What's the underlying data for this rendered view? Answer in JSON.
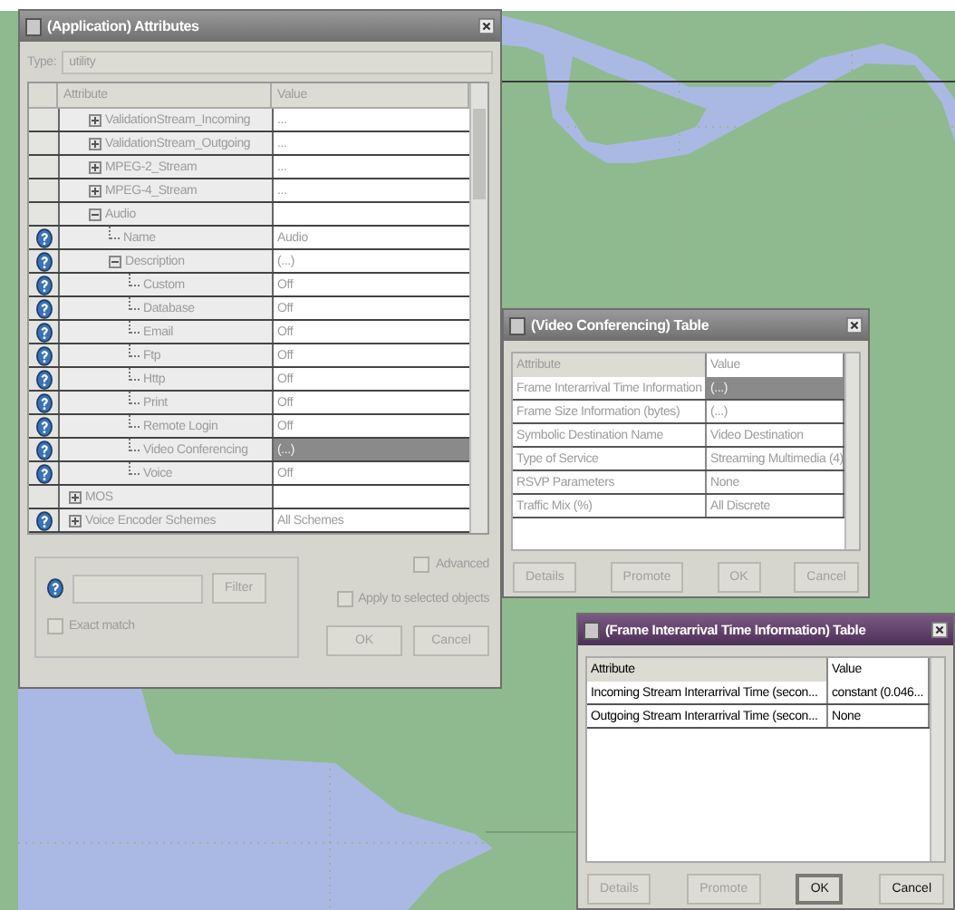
{
  "attributes_window": {
    "title": "(Application) Attributes",
    "active": false,
    "type_label": "Type:",
    "type_value": "utility",
    "columns": [
      "Attribute",
      "Value"
    ],
    "scrolled_rows": [
      {
        "attribute": "ValidationStream_Incoming",
        "value": "...",
        "help": false,
        "expanded": false,
        "selected": false
      },
      {
        "attribute": "ValidationStream_Outgoing",
        "value": "...",
        "help": false,
        "expanded": false,
        "selected": false
      },
      {
        "attribute": "MPEG-2_Stream",
        "value": "...",
        "help": false,
        "expanded": false,
        "selected": false
      },
      {
        "attribute": "MPEG-4_Stream",
        "value": "...",
        "help": false,
        "expanded": false,
        "selected": false
      },
      {
        "attribute": "Audio",
        "help": false,
        "expanded": true,
        "selected": false,
        "children": [
          {
            "attribute": "Name",
            "value": "Audio",
            "help": true,
            "selected": false
          },
          {
            "attribute": "Description",
            "value": "(...)",
            "help": true,
            "expanded": true,
            "selected": false,
            "children": [
              {
                "attribute": "Custom",
                "value": "Off",
                "help": true,
                "selected": false
              },
              {
                "attribute": "Database",
                "value": "Off",
                "help": true,
                "selected": false
              },
              {
                "attribute": "Email",
                "value": "Off",
                "help": true,
                "selected": false
              },
              {
                "attribute": "Ftp",
                "value": "Off",
                "help": true,
                "selected": false
              },
              {
                "attribute": "Http",
                "value": "Off",
                "help": true,
                "selected": false
              },
              {
                "attribute": "Print",
                "value": "Off",
                "help": true,
                "selected": false
              },
              {
                "attribute": "Remote Login",
                "value": "Off",
                "help": true,
                "selected": false
              },
              {
                "attribute": "Video Conferencing",
                "value": "(...)",
                "help": true,
                "selected": true
              },
              {
                "attribute": "Voice",
                "value": "Off",
                "help": true,
                "selected": false
              }
            ]
          }
        ]
      }
    ],
    "rows": [
      {
        "attribute": "MOS",
        "help": false,
        "expanded": false,
        "selected": false
      },
      {
        "attribute": "Voice Encoder Schemes",
        "value": "All Schemes",
        "help": true,
        "expanded": false,
        "selected": false
      }
    ],
    "filter_button": {
      "label": "Filter",
      "disabled": true
    },
    "exact_match": {
      "label": "Exact match",
      "checked": false
    },
    "advanced": {
      "label": "Advanced",
      "checked": false
    },
    "apply_selected": {
      "label": "Apply to selected objects",
      "checked": false
    },
    "buttons": [
      {
        "label": "OK",
        "disabled": true,
        "default": false
      },
      {
        "label": "Cancel",
        "disabled": true,
        "default": false
      }
    ]
  },
  "table_windows": [
    {
      "title": "(Video Conferencing) Table",
      "active": false,
      "columns": [
        "Attribute",
        "Value"
      ],
      "rows": [
        {
          "attribute": "Frame Interarrival Time Information",
          "value": "(...)",
          "selected": true
        },
        {
          "attribute": "Frame Size Information (bytes)",
          "value": "(...)",
          "selected": false
        },
        {
          "attribute": "Symbolic Destination Name",
          "value": "Video Destination",
          "selected": false
        },
        {
          "attribute": "Type of Service",
          "value": "Streaming Multimedia (4)",
          "selected": false
        },
        {
          "attribute": "RSVP Parameters",
          "value": "None",
          "selected": false
        },
        {
          "attribute": "Traffic Mix (%)",
          "value": "All Discrete",
          "selected": false
        }
      ],
      "buttons": [
        {
          "label": "Details",
          "disabled": true,
          "default": false
        },
        {
          "label": "Promote",
          "disabled": true,
          "default": false
        },
        {
          "label": "OK",
          "disabled": true,
          "default": false
        },
        {
          "label": "Cancel",
          "disabled": true,
          "default": false
        }
      ]
    },
    {
      "title": "(Frame Interarrival Time Information) Table",
      "active": true,
      "columns": [
        "Attribute",
        "Value"
      ],
      "rows": [
        {
          "attribute": "Incoming Stream Interarrival Time (secon...",
          "value": "constant (0.046...",
          "selected": false
        },
        {
          "attribute": "Outgoing Stream Interarrival Time (secon...",
          "value": "None",
          "selected": false
        }
      ],
      "buttons": [
        {
          "label": "Details",
          "disabled": true,
          "default": false
        },
        {
          "label": "Promote",
          "disabled": true,
          "default": false
        },
        {
          "label": "OK",
          "disabled": false,
          "default": true
        },
        {
          "label": "Cancel",
          "disabled": false,
          "default": false
        }
      ]
    }
  ]
}
